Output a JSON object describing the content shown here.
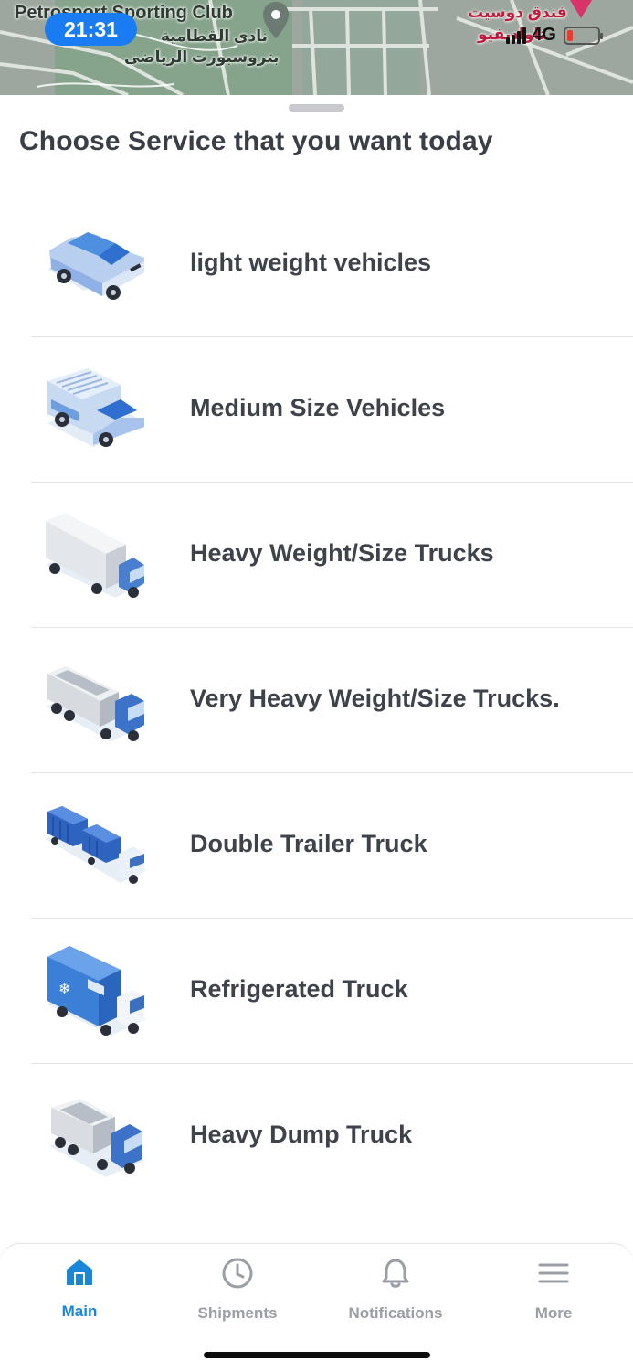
{
  "status_bar": {
    "time": "21:31",
    "network": "4G",
    "battery_level": 0.1
  },
  "map": {
    "labels": {
      "club_en": "Petrosport Sporting Club",
      "club_ar": "نادى القطامية",
      "club_ar2": "بتروسبورت الرياضى",
      "hotel_ar": "فندق دوسيت",
      "hotel_ar2": "تاواديفيو"
    }
  },
  "sheet": {
    "title": "Choose Service that you want today",
    "services": [
      {
        "label": "light weight vehicles",
        "icon": "car-icon"
      },
      {
        "label": "Medium Size Vehicles",
        "icon": "van-icon"
      },
      {
        "label": "Heavy Weight/Size Trucks",
        "icon": "box-truck-icon"
      },
      {
        "label": "Very Heavy Weight/Size Trucks.",
        "icon": "tipper-truck-icon"
      },
      {
        "label": "Double Trailer Truck",
        "icon": "double-trailer-truck-icon"
      },
      {
        "label": "Refrigerated Truck",
        "icon": "refrigerated-truck-icon"
      },
      {
        "label": "Heavy Dump Truck",
        "icon": "dump-truck-icon"
      }
    ]
  },
  "tabbar": {
    "tabs": [
      {
        "label": "Main",
        "icon": "home-icon",
        "active": true
      },
      {
        "label": "Shipments",
        "icon": "clock-icon",
        "active": false
      },
      {
        "label": "Notifications",
        "icon": "bell-icon",
        "active": false
      },
      {
        "label": "More",
        "icon": "menu-icon",
        "active": false
      }
    ]
  },
  "colors": {
    "accent": "#1a86d9",
    "time_pill": "#1a7cf2",
    "text": "#3a3f47",
    "inactive_tab": "#9a9ea5",
    "battery_low": "#ef3a2a"
  }
}
